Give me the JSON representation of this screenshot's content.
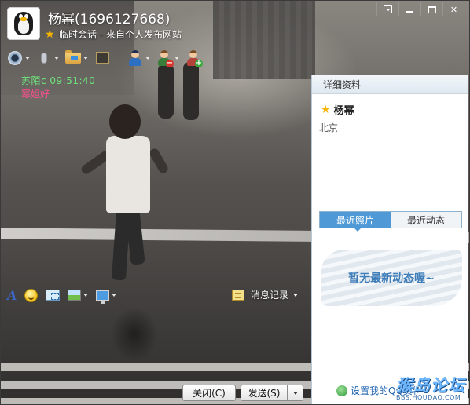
{
  "window": {
    "contact_name": "杨幂(1696127668)",
    "subtitle": "临时会话 - 来自个人发布网站"
  },
  "messages": [
    {
      "sender_time": "苏陌c  09:51:40",
      "text": "幂姐好"
    }
  ],
  "input_toolbar": {
    "history_label": "消息记录"
  },
  "buttons": {
    "close_label": "关闭(C)",
    "send_label": "发送(S)"
  },
  "panel": {
    "header": "详细资料",
    "name": "杨幂",
    "location": "北京",
    "tabs": [
      {
        "label": "最近照片",
        "active": true
      },
      {
        "label": "最近动态",
        "active": false
      }
    ],
    "empty_message": "暂无最新动态喔~",
    "settings_link": "设置我的QQ资料"
  },
  "watermark": {
    "title": "猴岛论坛",
    "url": "BBS.HOUDAO.COM"
  },
  "icons": {
    "toolbar": [
      "video-call-icon",
      "voice-call-icon",
      "file-transfer-icon",
      "film-icon",
      "police-person-icon",
      "remove-contact-icon",
      "add-contact-icon"
    ],
    "input": [
      "font-icon",
      "emoji-icon",
      "screenshot-icon",
      "image-icon",
      "screen-share-icon",
      "history-icon"
    ]
  },
  "colors": {
    "sender_time": "#6ee37a",
    "message_text": "#ff4f8f",
    "tab_active": "#4f9ad6",
    "link": "#1f64b0",
    "star": "#f5b400"
  }
}
